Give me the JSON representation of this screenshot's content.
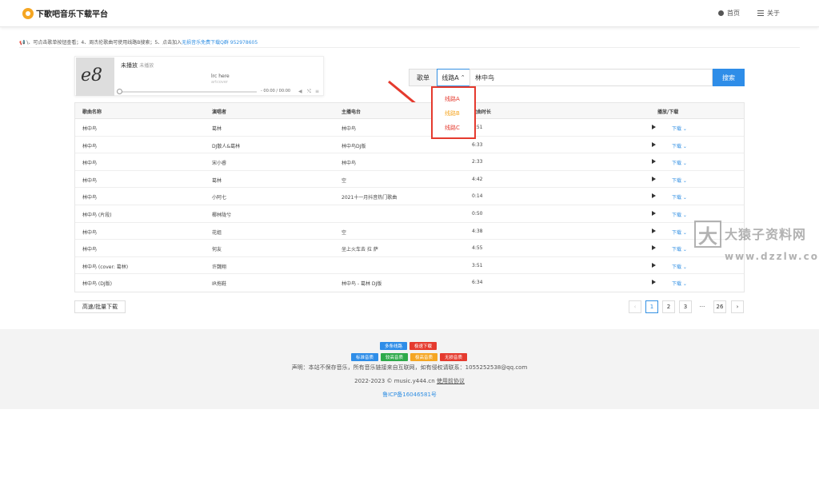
{
  "header": {
    "logo_text": "下歌吧音乐下载平台",
    "nav_home": "首页",
    "nav_about": "关于"
  },
  "notice": {
    "text": "📢 \\、可点击歌单按钮查看；4、周杰伦歌曲可使用线路B搜索；5、点击加入",
    "link": "无损音乐免费下载Q群 952978605"
  },
  "player": {
    "cover_text": "e8",
    "title": "未播放",
    "subtitle": "未播放",
    "lrc": "lrc here",
    "lrc_sub": "artcover",
    "time": "- 00:00 / 00:00",
    "progress": 0
  },
  "search": {
    "playlist_label": "歌单",
    "route_label": "线路A",
    "route_chevron": "⌃",
    "query": "林中鸟",
    "button": "搜索"
  },
  "dropdown": {
    "items": [
      {
        "label": "线路A",
        "color": "#e53a2e"
      },
      {
        "label": "线路B",
        "color": "#f5a623"
      },
      {
        "label": "线路C",
        "color": "#e53a2e"
      }
    ]
  },
  "table": {
    "headers": [
      "歌曲名称",
      "演唱者",
      "主播电台",
      "歌曲时长",
      "播放/下载"
    ],
    "download_label": "下载 ⌄",
    "rows": [
      [
        "林中鸟",
        "葛林",
        "林中鸟",
        "3:51"
      ],
      [
        "林中鸟",
        "DJ散人&葛林",
        "林中鸟DJ版",
        "6:33"
      ],
      [
        "林中鸟",
        "宋小睿",
        "林中鸟",
        "2:33"
      ],
      [
        "林中鸟",
        "葛林",
        "空",
        "4:42"
      ],
      [
        "林中鸟",
        "小阿七",
        "2021十一月抖音热门歌曲",
        "0:14"
      ],
      [
        "林中鸟 (片段)",
        "椰林陇兮",
        "",
        "0:50"
      ],
      [
        "林中鸟",
        "花姐",
        "空",
        "4:38"
      ],
      [
        "林中鸟",
        "何友",
        "坐上火车去 拉 萨",
        "4:55"
      ],
      [
        "林中鸟 (cover: 葛林)",
        "许魏翔",
        "",
        "3:51"
      ],
      [
        "林中鸟 (DJ版)",
        "IR拖鞋",
        "林中鸟 - 葛林 DJ版",
        "6:34"
      ]
    ]
  },
  "bulk_button": "高速/批量下载",
  "pager": {
    "prev": "‹",
    "pages": [
      "1",
      "2",
      "3"
    ],
    "ellipsis": "···",
    "last": "26",
    "next": "›"
  },
  "footer": {
    "tags_row1": [
      {
        "label": "多条线路",
        "color": "#2e8de8"
      },
      {
        "label": "极速下载",
        "color": "#e53a2e"
      }
    ],
    "tags_row2": [
      {
        "label": "标准音质",
        "color": "#2e8de8"
      },
      {
        "label": "较高音质",
        "color": "#2eaa4a"
      },
      {
        "label": "极高音质",
        "color": "#f5a623"
      },
      {
        "label": "无损音质",
        "color": "#e53a2e"
      }
    ],
    "statement": "声明：本站不保存音乐，所有音乐链接来自互联网，如有侵权请联系：1055252538@qq.com",
    "copyright": "2022-2023 © music.y444.cn ",
    "copyright_link": "使用前协议",
    "icp": "鲁ICP备16046581号"
  },
  "watermark": {
    "logo": "大",
    "cn": "大猿子资料网",
    "en": "www.dzzlw.com"
  }
}
